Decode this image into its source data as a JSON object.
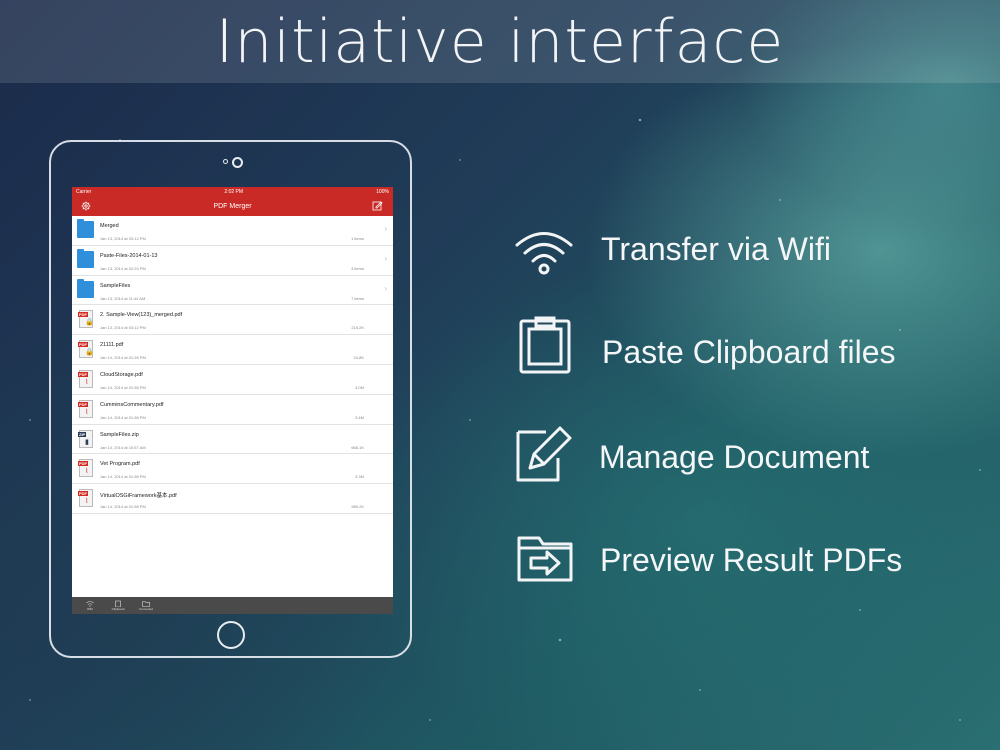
{
  "banner": {
    "title": "Initiative interface"
  },
  "device": {
    "status": {
      "carrier": "Carrier",
      "time": "2:02 PM",
      "battery": "100%"
    },
    "nav": {
      "title": "PDF Merger"
    },
    "files": [
      {
        "name": "Merged",
        "date": "Jan 13, 2014 at 03:12 PM",
        "info": "1 items",
        "kind": "folder"
      },
      {
        "name": "Paste-Files-2014-01-13",
        "date": "Jan 13, 2014 at 02:24 PM",
        "info": "3 items",
        "kind": "folder"
      },
      {
        "name": "SampleFiles",
        "date": "Jan 13, 2014 at 11:44 AM",
        "info": "7 items",
        "kind": "folder"
      },
      {
        "name": "2. Sample-View(123)_merged.pdf",
        "date": "Jan 13, 2014 at 03:12 PM",
        "info": "218.2K",
        "kind": "pdf-lock"
      },
      {
        "name": "21111.pdf",
        "date": "Jan 14, 2014 at 01:28 PM",
        "info": "24.8K",
        "kind": "pdf-lock"
      },
      {
        "name": "CloudStorage.pdf",
        "date": "Jan 14, 2014 at 01:58 PM",
        "info": "3.0M",
        "kind": "pdf"
      },
      {
        "name": "CumminsCommentary.pdf",
        "date": "Jan 14, 2014 at 01:58 PM",
        "info": "3.4M",
        "kind": "pdf"
      },
      {
        "name": "SampleFiles.zip",
        "date": "Jan 14, 2014 at 10:57 AM",
        "info": "668.1K",
        "kind": "zip"
      },
      {
        "name": "Vet Program.pdf",
        "date": "Jan 14, 2014 at 01:58 PM",
        "info": "3.3M",
        "kind": "pdf"
      },
      {
        "name": "VirtualOSGiFramework基本.pdf",
        "date": "Jan 14, 2014 at 01:58 PM",
        "info": "989.2K",
        "kind": "pdf"
      }
    ],
    "tabs": [
      {
        "label": "WiFi",
        "icon": "wifi-icon"
      },
      {
        "label": "Clipboard",
        "icon": "clipboard-icon"
      },
      {
        "label": "Converted",
        "icon": "folder-icon"
      }
    ]
  },
  "features": [
    {
      "label": "Transfer via Wifi",
      "icon": "wifi-icon"
    },
    {
      "label": "Paste Clipboard files",
      "icon": "clipboard-icon"
    },
    {
      "label": "Manage Document",
      "icon": "edit-document-icon"
    },
    {
      "label": "Preview Result PDFs",
      "icon": "folder-arrow-icon"
    }
  ],
  "colors": {
    "accent": "#c92a25",
    "tabbar": "#4a4a4a"
  }
}
